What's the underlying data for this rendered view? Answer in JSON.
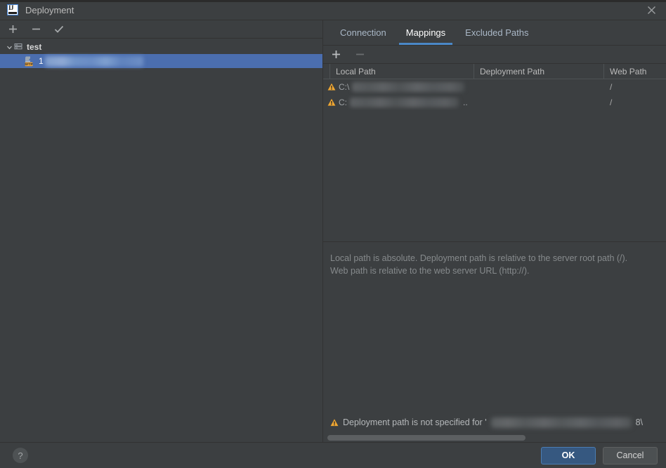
{
  "window": {
    "title": "Deployment",
    "app_icon": "intellij-idea-icon",
    "close_icon": "close-icon"
  },
  "left_panel": {
    "toolbar": [
      {
        "name": "add-server-button",
        "icon": "plus-icon",
        "label": "+",
        "enabled": true
      },
      {
        "name": "remove-server-button",
        "icon": "minus-icon",
        "label": "−",
        "enabled": true
      },
      {
        "name": "set-default-server-button",
        "icon": "check-icon",
        "label": "✓",
        "enabled": true
      }
    ],
    "tree": [
      {
        "name": "tree-group-test",
        "label": "test",
        "icon": "server-group-icon",
        "expanded": true,
        "chevron": "chevron-down-icon",
        "selected": false
      },
      {
        "name": "tree-item-sftp-server",
        "label": "1",
        "label_redacted": true,
        "icon": "sftp-server-icon",
        "badge": "SFTP",
        "selected": true
      }
    ]
  },
  "right_panel": {
    "tabs": [
      {
        "name": "tab-connection",
        "label": "Connection",
        "active": false
      },
      {
        "name": "tab-mappings",
        "label": "Mappings",
        "active": true
      },
      {
        "name": "tab-excluded-paths",
        "label": "Excluded Paths",
        "active": false
      }
    ],
    "table_toolbar": [
      {
        "name": "add-mapping-button",
        "icon": "plus-icon",
        "label": "+",
        "enabled": true
      },
      {
        "name": "remove-mapping-button",
        "icon": "minus-icon",
        "label": "−",
        "enabled": false
      }
    ],
    "table": {
      "columns": [
        "Local Path",
        "Deployment Path",
        "Web Path"
      ],
      "rows": [
        {
          "warning": true,
          "warning_icon": "warning-triangle-icon",
          "local_path_prefix": "C:\\",
          "local_path_redacted": true,
          "deployment_path": "",
          "web_path": "/"
        },
        {
          "warning": true,
          "warning_icon": "warning-triangle-icon",
          "local_path_prefix": "C:",
          "local_path_redacted": true,
          "local_path_suffix": "..",
          "deployment_path": "",
          "web_path": "/"
        }
      ]
    },
    "hint": {
      "line1": "Local path is absolute. Deployment path is relative to the server root path (/).",
      "line2": "Web path is relative to the web server URL (http://)."
    },
    "status": {
      "icon": "warning-triangle-icon",
      "text": "Deployment path is not specified for '",
      "redacted": true,
      "tail": "8\\"
    }
  },
  "footer": {
    "help": {
      "name": "help-button",
      "icon": "question-mark-icon",
      "label": "?"
    },
    "ok": {
      "name": "ok-button",
      "label": "OK"
    },
    "cancel": {
      "name": "cancel-button",
      "label": "Cancel"
    }
  },
  "colors": {
    "background": "#3c3f41",
    "selection": "#4b6eaf",
    "accent": "#4a88c7",
    "primary_button": "#365880",
    "warning": "#f0a732",
    "text": "#bbbbbb",
    "muted_text": "#868a8c"
  }
}
